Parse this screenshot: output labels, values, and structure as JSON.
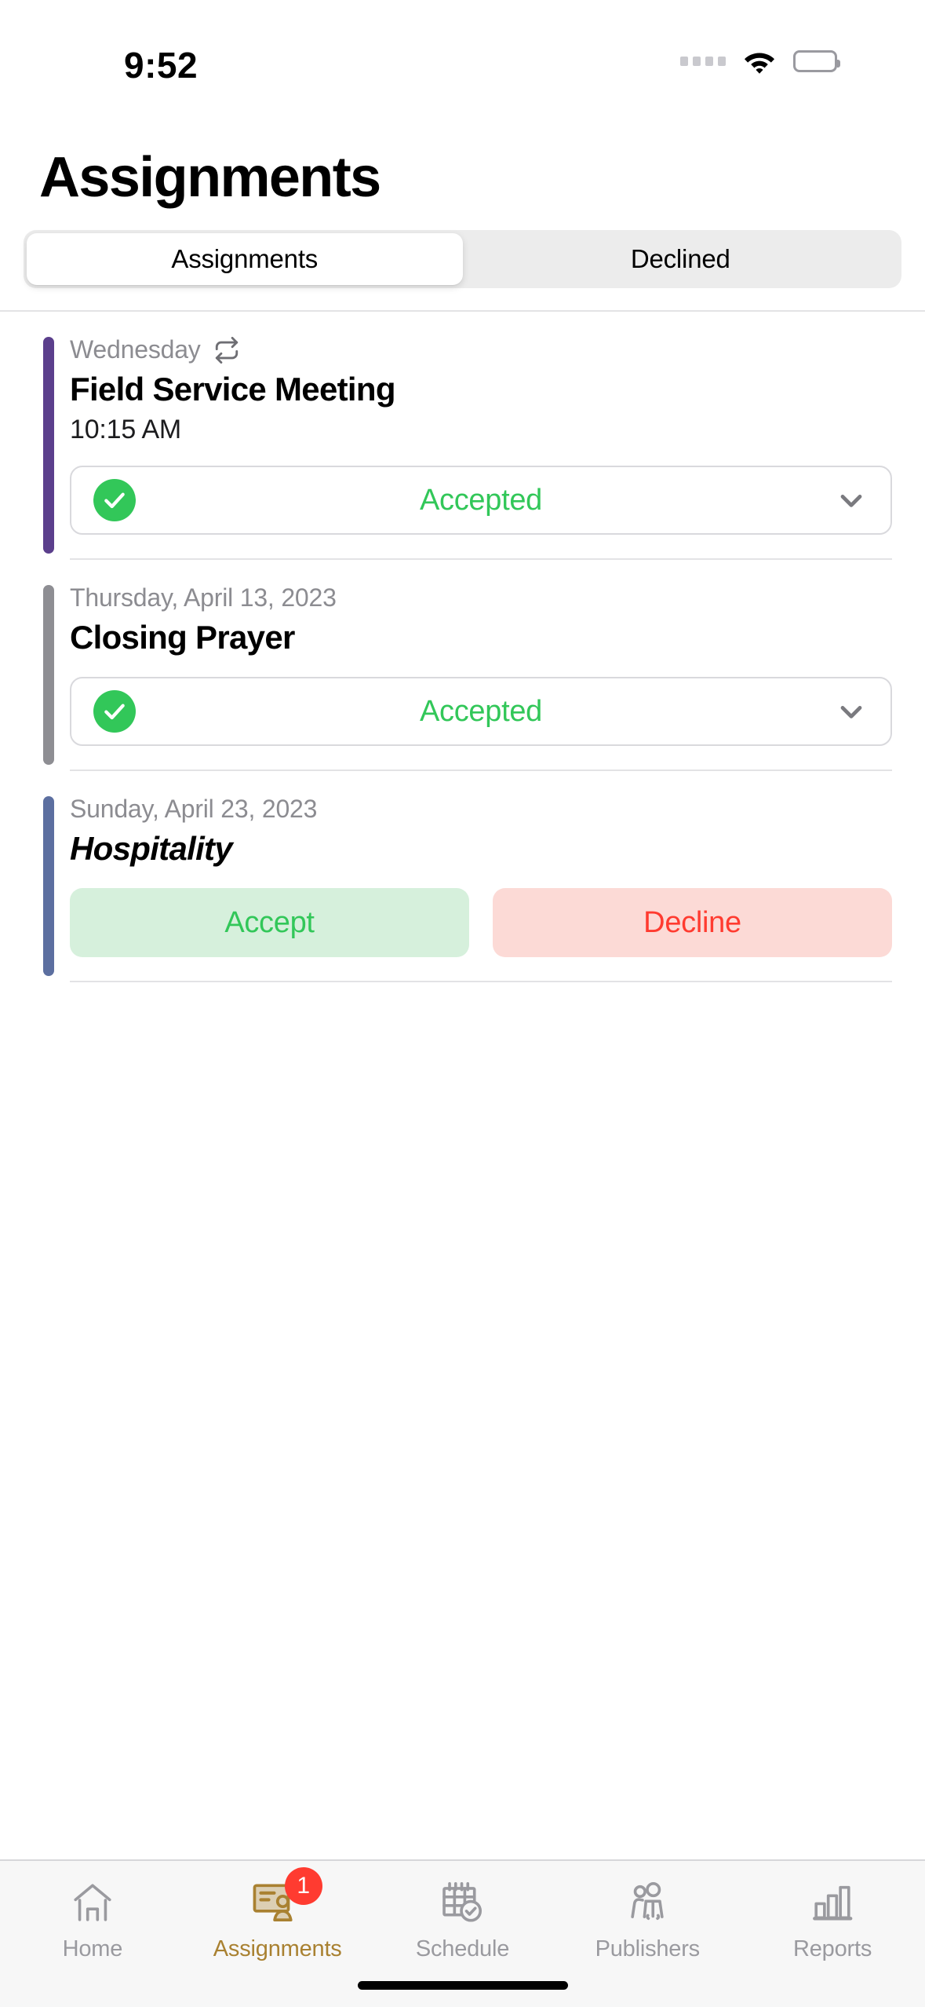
{
  "status_bar": {
    "time": "9:52",
    "cellular_icon": "cellular-dots-icon",
    "wifi_icon": "wifi-icon",
    "battery_icon": "battery-full-icon"
  },
  "header": {
    "title": "Assignments"
  },
  "segmented_control": {
    "selected": "Assignments",
    "options": [
      {
        "label": "Assignments",
        "active": true
      },
      {
        "label": "Declined",
        "active": false
      }
    ]
  },
  "assignments": [
    {
      "accent_color": "#5B3F8C",
      "date": "Wednesday",
      "recurring": true,
      "recurring_icon": "repeat-icon",
      "title": "Field Service Meeting",
      "title_italic": false,
      "time": "10:15 AM",
      "status": {
        "type": "accepted",
        "label": "Accepted",
        "check_icon": "check-circle-icon",
        "chevron_icon": "chevron-down-icon",
        "color": "#32C759"
      }
    },
    {
      "accent_color": "#8E8E93",
      "date": "Thursday, April 13, 2023",
      "recurring": false,
      "title": "Closing Prayer",
      "title_italic": false,
      "time": "",
      "status": {
        "type": "accepted",
        "label": "Accepted",
        "check_icon": "check-circle-icon",
        "chevron_icon": "chevron-down-icon",
        "color": "#32C759"
      }
    },
    {
      "accent_color": "#5C6FA0",
      "date": "Sunday, April 23, 2023",
      "recurring": false,
      "title": "Hospitality",
      "title_italic": true,
      "time": "",
      "status": {
        "type": "pending",
        "accept_label": "Accept",
        "decline_label": "Decline",
        "accept_color": "#32C759",
        "decline_color": "#FF3B30"
      }
    }
  ],
  "tab_bar": {
    "active": "Assignments",
    "tabs": [
      {
        "label": "Home",
        "icon": "home-icon",
        "active": false,
        "badge": ""
      },
      {
        "label": "Assignments",
        "icon": "id-card-person-icon",
        "active": true,
        "badge": "1"
      },
      {
        "label": "Schedule",
        "icon": "calendar-check-icon",
        "active": false,
        "badge": ""
      },
      {
        "label": "Publishers",
        "icon": "people-icon",
        "active": false,
        "badge": ""
      },
      {
        "label": "Reports",
        "icon": "bar-chart-icon",
        "active": false,
        "badge": ""
      }
    ],
    "active_color": "#A98131",
    "inactive_color": "#9A9A9F",
    "badge_color": "#FF3B30"
  },
  "home_indicator": "home-indicator"
}
